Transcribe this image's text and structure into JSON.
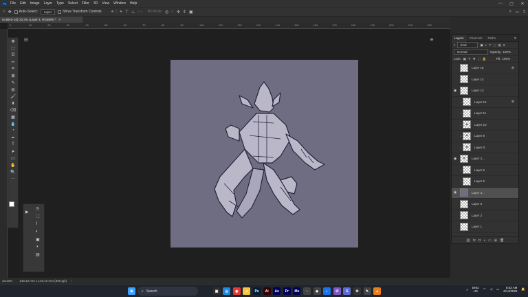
{
  "menubar": {
    "items": [
      "File",
      "Edit",
      "Image",
      "Layer",
      "Type",
      "Select",
      "Filter",
      "3D",
      "View",
      "Window",
      "Help"
    ],
    "logo": "Ps"
  },
  "window_controls": [
    "—",
    "▢",
    "✕"
  ],
  "options_bar": {
    "auto_select_label": "Auto-Select:",
    "auto_select_value": "Layer",
    "transform_label": "Show Transform Controls",
    "mode_label": "3D Mode:"
  },
  "document_tab": {
    "title": "Untitled-1@ 33.3% (Layer 4, RGB/8#) *",
    "close": "×"
  },
  "ruler_ticks": [
    "0",
    "10",
    "20",
    "30",
    "40",
    "50",
    "60",
    "70",
    "80",
    "90",
    "100",
    "110",
    "120",
    "130",
    "140",
    "150",
    "160",
    "170",
    "180",
    "190",
    "200",
    "210",
    "220"
  ],
  "tools": [
    "✥",
    "⬚",
    "ʘ",
    "✂",
    "⌗",
    "⊠",
    "✎",
    "◍",
    "🖌",
    "⬍",
    "⌫",
    "▦",
    "💧",
    "◔",
    "✒",
    "T",
    "➤",
    "▭",
    "✋",
    "🔍",
    "···"
  ],
  "float_panel": [
    "▶",
    "◷",
    "⬚",
    "⌇",
    "◐",
    "▣",
    "◑",
    "▤"
  ],
  "status_bar": {
    "zoom": "33.33%",
    "dimensions": "148.43 mm x 148.43 mm (300 ppi)"
  },
  "layers_panel": {
    "tabs": [
      "Layers",
      "Channels",
      "Paths"
    ],
    "kind_label": "Kind",
    "blend_mode": "Normal",
    "opacity_label": "Opacity:",
    "opacity_value": "100%",
    "lock_label": "Lock:",
    "fill_label": "Fill:",
    "fill_value": "100%",
    "layers": [
      {
        "name": "Layer 15",
        "visible": false,
        "clipped": false,
        "active": false,
        "badge": "⊛",
        "thumb": "checker"
      },
      {
        "name": "Layer 14",
        "visible": false,
        "clipped": false,
        "active": false,
        "badge": "",
        "thumb": "checker"
      },
      {
        "name": "Layer 13",
        "visible": true,
        "clipped": false,
        "active": false,
        "badge": "",
        "thumb": "checker"
      },
      {
        "name": "Layer 12",
        "visible": false,
        "clipped": true,
        "active": false,
        "badge": "⊛",
        "thumb": "checker"
      },
      {
        "name": "Layer 11",
        "visible": false,
        "clipped": true,
        "active": false,
        "badge": "",
        "thumb": "checker"
      },
      {
        "name": "Layer 10",
        "visible": false,
        "clipped": true,
        "active": false,
        "badge": "",
        "thumb": "figure"
      },
      {
        "name": "Layer 9",
        "visible": false,
        "clipped": true,
        "active": false,
        "badge": "",
        "thumb": "figure"
      },
      {
        "name": "Layer 8",
        "visible": false,
        "clipped": true,
        "active": false,
        "badge": "",
        "thumb": "figure"
      },
      {
        "name": "Layer 2...",
        "visible": true,
        "clipped": false,
        "active": false,
        "badge": "",
        "thumb": "figure"
      },
      {
        "name": "Layer 6",
        "visible": false,
        "clipped": true,
        "active": false,
        "badge": "",
        "thumb": "checker"
      },
      {
        "name": "Layer 5",
        "visible": false,
        "clipped": true,
        "active": false,
        "badge": "",
        "thumb": "checker"
      },
      {
        "name": "Layer 4...",
        "visible": true,
        "clipped": false,
        "active": true,
        "badge": "",
        "thumb": "purple"
      },
      {
        "name": "Layer 3",
        "visible": false,
        "clipped": false,
        "active": false,
        "badge": "",
        "thumb": "checker"
      },
      {
        "name": "Layer 2",
        "visible": false,
        "clipped": false,
        "active": false,
        "badge": "",
        "thumb": "checker"
      },
      {
        "name": "Layer 1",
        "visible": false,
        "clipped": false,
        "active": false,
        "badge": "",
        "thumb": "checker"
      }
    ],
    "footer_icons": [
      "⛓",
      "fx",
      "◘",
      "◑",
      "▭",
      "⊞",
      "🗑"
    ]
  },
  "taskbar": {
    "search_placeholder": "Search",
    "apps": [
      {
        "label": "⊞",
        "color": "#3aa0ff"
      },
      {
        "label": "▣",
        "color": "#2d2d2d"
      },
      {
        "label": "◎",
        "color": "#1e88e5"
      },
      {
        "label": "◉",
        "color": "#e53935"
      },
      {
        "label": "📁",
        "color": "#f6c343"
      },
      {
        "label": "Ps",
        "color": "#001e36"
      },
      {
        "label": "Ai",
        "color": "#330000"
      },
      {
        "label": "Ae",
        "color": "#00005b"
      },
      {
        "label": "Pr",
        "color": "#00005b"
      },
      {
        "label": "Me",
        "color": "#00005b"
      },
      {
        "label": "◌",
        "color": "#444"
      },
      {
        "label": "◆",
        "color": "#444"
      },
      {
        "label": "◐",
        "color": "#1a73e8"
      },
      {
        "label": "✆",
        "color": "#7e57c2"
      },
      {
        "label": "S",
        "color": "#5b6bd5"
      },
      {
        "label": "⚙",
        "color": "#333"
      },
      {
        "label": "✎",
        "color": "#444"
      },
      {
        "label": "▲",
        "color": "#e67e22"
      }
    ],
    "lang": "ENG",
    "region": "US",
    "time": "8:53 AM",
    "date": "6/14/2025"
  }
}
